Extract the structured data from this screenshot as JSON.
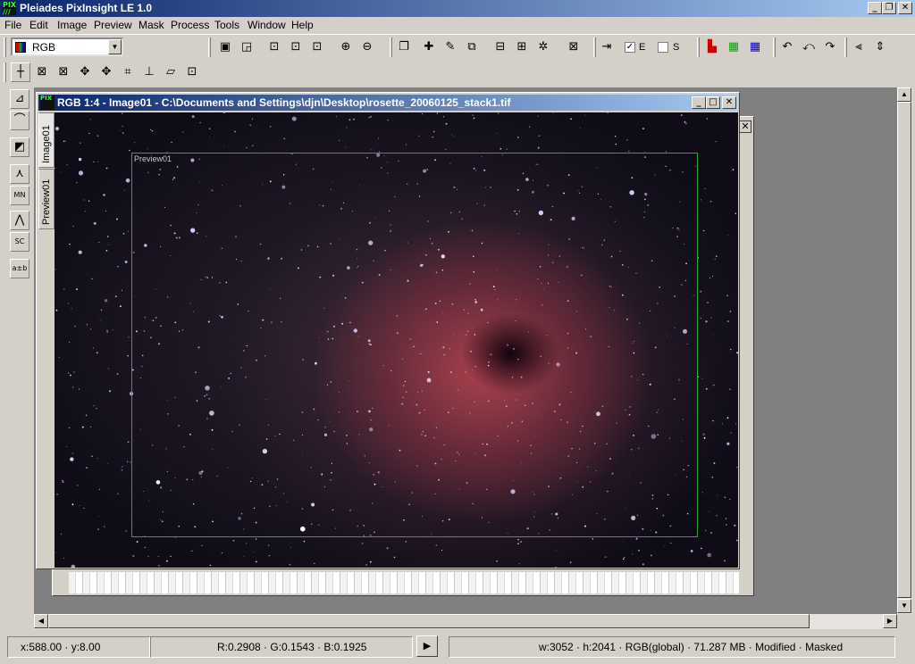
{
  "app": {
    "title": "Pleiades PixInsight LE 1.0"
  },
  "menu": [
    "File",
    "Edit",
    "Image",
    "Preview",
    "Mask",
    "Process",
    "Tools",
    "Window",
    "Help"
  ],
  "toolbar": {
    "colorspace_value": "RGB",
    "check_e_label": "E",
    "check_s_label": "S",
    "check_e_checked": "✓"
  },
  "image_window": {
    "title": "RGB 1:4 - Image01 - C:\\Documents and Settings\\djn\\Desktop\\rosette_20060125_stack1.tif",
    "tabs": [
      "Image01",
      "Preview01"
    ],
    "preview_label": "Preview01"
  },
  "status": {
    "coords": "x:588.00 · y:8.00",
    "rgb": "R:0.2908 · G:0.1543 · B:0.1925",
    "info": "w:3052 · h:2041 · RGB(global) · 71.287 MB · Modified · Masked"
  },
  "colors": {
    "titlebar_start": "#0a246a",
    "titlebar_end": "#a6caf0",
    "preview_border": "#2ea82e",
    "nebula": "#b94650"
  }
}
